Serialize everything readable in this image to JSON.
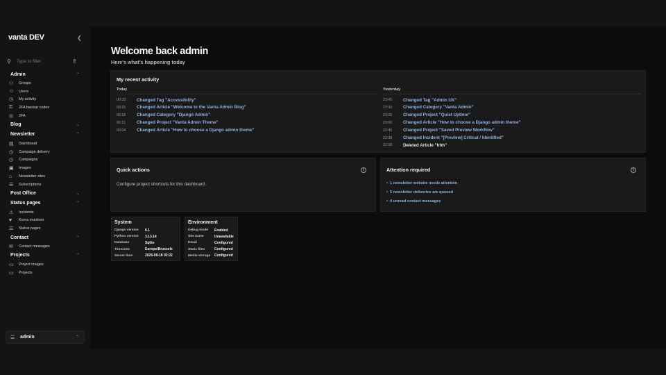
{
  "app": {
    "brand": "vanta DEV"
  },
  "filter": {
    "placeholder": "Type to filter"
  },
  "nav": [
    {
      "label": "Admin",
      "expanded": true,
      "items": [
        {
          "label": "Groups",
          "icon": "users-icon"
        },
        {
          "label": "Users",
          "icon": "user-icon"
        },
        {
          "label": "My activity",
          "icon": "clock-icon"
        },
        {
          "label": "2FA backup codes",
          "icon": "key-icon"
        },
        {
          "label": "2FA",
          "icon": "shield-icon"
        }
      ]
    },
    {
      "label": "Blog",
      "expanded": false,
      "items": []
    },
    {
      "label": "Newsletter",
      "expanded": true,
      "items": [
        {
          "label": "Dashboard",
          "icon": "dashboard-icon"
        },
        {
          "label": "Campaign delivery",
          "icon": "clock-icon"
        },
        {
          "label": "Campaigns",
          "icon": "clock-icon"
        },
        {
          "label": "Images",
          "icon": "image-icon"
        },
        {
          "label": "Newsletter sites",
          "icon": "lock-icon"
        },
        {
          "label": "Subscriptions",
          "icon": "list-icon"
        }
      ]
    },
    {
      "label": "Post Office",
      "expanded": false,
      "items": []
    },
    {
      "label": "Status pages",
      "expanded": true,
      "items": [
        {
          "label": "Incidents",
          "icon": "warning-icon"
        },
        {
          "label": "Kuma monitors",
          "icon": "heart-icon"
        },
        {
          "label": "Status pages",
          "icon": "list-icon"
        }
      ]
    },
    {
      "label": "Contact",
      "expanded": true,
      "items": [
        {
          "label": "Contact messages",
          "icon": "mail-icon"
        }
      ]
    },
    {
      "label": "Projects",
      "expanded": true,
      "items": [
        {
          "label": "Project images",
          "icon": "folder-icon"
        },
        {
          "label": "Projects",
          "icon": "folder-icon"
        }
      ]
    }
  ],
  "user": {
    "name": "admin"
  },
  "header": {
    "title": "Welcome back admin",
    "subtitle": "Here's what's happening today"
  },
  "activity": {
    "title": "My recent activity",
    "today": {
      "label": "Today",
      "rows": [
        {
          "time": "00:33",
          "text": "Changed Tag \"Accessibility\"",
          "link": true
        },
        {
          "time": "00:25",
          "text": "Changed Article \"Welcome to the Vanta Admin Blog\"",
          "link": true
        },
        {
          "time": "00:18",
          "text": "Changed Category \"Django Admin\"",
          "link": true
        },
        {
          "time": "00:11",
          "text": "Changed Project \"Vanta Admin Theme\"",
          "link": true
        },
        {
          "time": "00:04",
          "text": "Changed Article \"How to choose a Django admin theme\"",
          "link": true
        }
      ]
    },
    "yesterday": {
      "label": "Yesterday",
      "rows": [
        {
          "time": "23:45",
          "text": "Changed Tag \"Admin UX\"",
          "link": true
        },
        {
          "time": "23:30",
          "text": "Changed Category \"Vanta Admin\"",
          "link": true
        },
        {
          "time": "23:15",
          "text": "Changed Project \"Quiet Uptime\"",
          "link": true
        },
        {
          "time": "23:00",
          "text": "Changed Article \"How to choose a Django admin theme\"",
          "link": true
        },
        {
          "time": "22:45",
          "text": "Changed Project \"Saved Preview Workflow\"",
          "link": true
        },
        {
          "time": "22:38",
          "text": "Changed Incident \"[Preview] Critical / Identified\"",
          "link": true
        },
        {
          "time": "22:38",
          "text": "Deleted Article \"hhh\"",
          "link": false
        }
      ]
    }
  },
  "quick_actions": {
    "title": "Quick actions",
    "text": "Configure project shortcuts for this dashboard."
  },
  "attention": {
    "title": "Attention required",
    "items": [
      "1 newsletter website needs attention",
      "5 newsletter deliveries are queued",
      "4 unread contact messages"
    ]
  },
  "system": {
    "title": "System",
    "rows": [
      {
        "k": "Django version",
        "v": "6.1"
      },
      {
        "k": "Python version",
        "v": "3.13.14"
      },
      {
        "k": "Database",
        "v": "Sqlite"
      },
      {
        "k": "Timezone",
        "v": "Europe/Brussels"
      },
      {
        "k": "Server time",
        "v": "2026-08-18 02:22"
      }
    ]
  },
  "environment": {
    "title": "Environment",
    "rows": [
      {
        "k": "Debug mode",
        "v": "Enabled"
      },
      {
        "k": "Site name",
        "v": "Unavailable"
      },
      {
        "k": "Email",
        "v": "Configured"
      },
      {
        "k": "Static files",
        "v": "Configured"
      },
      {
        "k": "Media storage",
        "v": "Configured"
      }
    ]
  }
}
